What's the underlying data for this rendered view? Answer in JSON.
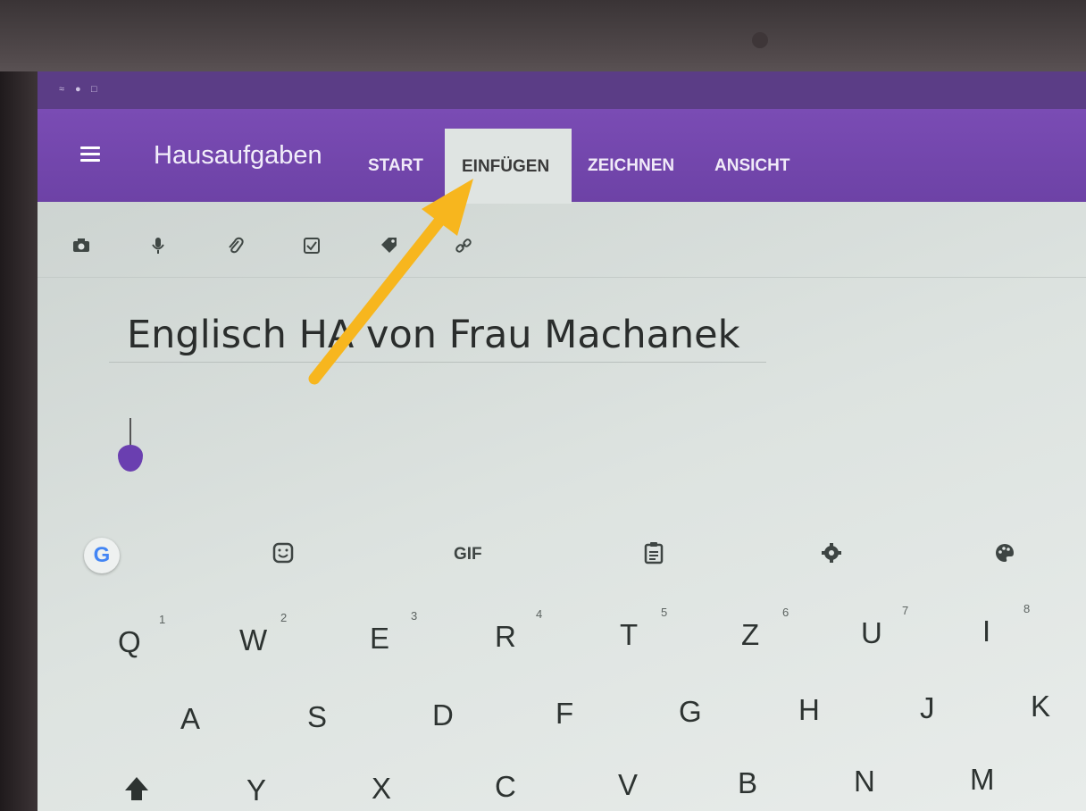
{
  "app": {
    "title": "Hausaufgaben",
    "tabs": [
      "START",
      "EINFÜGEN",
      "ZEICHNEN",
      "ANSICHT"
    ],
    "active_tab": "EINFÜGEN",
    "accent_color": "#6d42a6"
  },
  "ribbon_icons": [
    "camera-icon",
    "microphone-icon",
    "paperclip-icon",
    "checkbox-icon",
    "tag-icon",
    "link-icon"
  ],
  "note": {
    "title": "Englisch HA von Frau Machanek"
  },
  "keyboard": {
    "toolbar": {
      "google": "G",
      "gif": "GIF"
    },
    "row1": [
      {
        "key": "Q",
        "hint": "1"
      },
      {
        "key": "W",
        "hint": "2"
      },
      {
        "key": "E",
        "hint": "3"
      },
      {
        "key": "R",
        "hint": "4"
      },
      {
        "key": "T",
        "hint": "5"
      },
      {
        "key": "Z",
        "hint": "6"
      },
      {
        "key": "U",
        "hint": "7"
      },
      {
        "key": "I",
        "hint": "8"
      }
    ],
    "row2": [
      "A",
      "S",
      "D",
      "F",
      "G",
      "H",
      "J",
      "K"
    ],
    "row3": [
      "Y",
      "X",
      "C",
      "V",
      "B",
      "N",
      "M"
    ]
  }
}
